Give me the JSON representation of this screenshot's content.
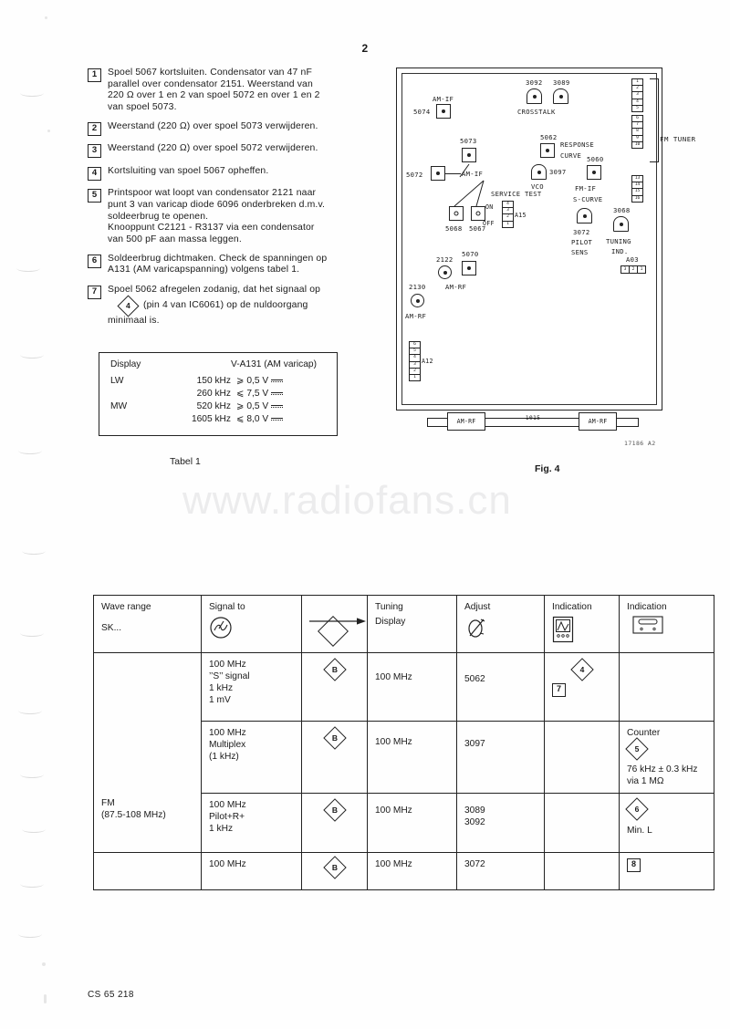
{
  "page": {
    "number": "2",
    "footer_code": "CS 65 218",
    "watermark": "www.radiofans.cn"
  },
  "instructions": [
    {
      "num": "1",
      "lines": [
        "Spoel 5067 kortsluiten. Condensator van 47 nF",
        "parallel over condensator 2151. Weerstand van",
        "220 Ω over 1 en 2 van spoel 5072 en over 1 en 2",
        "van spoel 5073."
      ]
    },
    {
      "num": "2",
      "lines": [
        "Weerstand (220 Ω) over spoel 5073 verwijderen."
      ]
    },
    {
      "num": "3",
      "lines": [
        "Weerstand (220 Ω) over spoel 5072 verwijderen."
      ]
    },
    {
      "num": "4",
      "lines": [
        "Kortsluiting van spoel 5067 opheffen."
      ]
    },
    {
      "num": "5",
      "lines": [
        "Printspoor wat loopt van condensator 2121 naar",
        "punt 3 van varicap diode 6096 onderbreken d.m.v.",
        "soldeerbrug te openen.",
        "Knooppunt C2121 - R3137 via een condensator",
        "van 500 pF aan massa leggen."
      ]
    },
    {
      "num": "6",
      "lines": [
        "Soldeerbrug dichtmaken. Check de spanningen op",
        "A131 (AM varicapspanning) volgens tabel 1."
      ]
    },
    {
      "num": "7",
      "lines": [
        "Spoel 5062 afregelen zodanig, dat het signaal op"
      ],
      "diamond_ref": "4",
      "after_diamond": "(pin 4 van IC6061) op de nuldoorgang",
      "tail": "minimaal is."
    }
  ],
  "tabel1": {
    "caption": "Tabel 1",
    "header": {
      "col1": "Display",
      "col2": "V-A131 (AM varicap)"
    },
    "rows": [
      {
        "band": "LW",
        "freq": "150 kHz",
        "value": "⩾ 0,5 V"
      },
      {
        "band": "",
        "freq": "260 kHz",
        "value": "⩽ 7,5 V"
      },
      {
        "band": "MW",
        "freq": "520 kHz",
        "value": "⩾ 0,5 V"
      },
      {
        "band": "",
        "freq": "1605 kHz",
        "value": "⩽ 8,0 V"
      }
    ]
  },
  "fig4": {
    "caption": "Fig. 4",
    "code": "17186 A2",
    "fm_tuner_label": "FM TUNER",
    "components": [
      {
        "id": "5074",
        "label": "AM-IF"
      },
      {
        "id": "5073",
        "label": "AM-IF"
      },
      {
        "id": "5072",
        "label": "AM-IF"
      },
      {
        "id": "5068",
        "label": ""
      },
      {
        "id": "5067",
        "label": ""
      },
      {
        "id": "3092",
        "label": "CROSSTALK"
      },
      {
        "id": "3089",
        "label": "CROSSTALK"
      },
      {
        "id": "5062",
        "label": "RESPONSE CURVE"
      },
      {
        "id": "3097",
        "label": "VCO"
      },
      {
        "id": "5060",
        "label": "FM-IF S-CURVE"
      },
      {
        "id": "3072",
        "label": "PILOT SENS"
      },
      {
        "id": "3068",
        "label": "TUNING IND."
      },
      {
        "id": "2122",
        "label": "AM-RF"
      },
      {
        "id": "5070",
        "label": "AM-RF"
      },
      {
        "id": "2130",
        "label": "AM-RF"
      }
    ],
    "service_test": {
      "title": "SERVICE TEST",
      "on": "ON",
      "off": "OFF",
      "connector": "A15"
    },
    "connectors": {
      "a12": "A12",
      "a03": "A03",
      "a03_pins": [
        "3",
        "2",
        "1"
      ],
      "a12_pins": [
        "6",
        "5",
        "4",
        "3",
        "2",
        "1"
      ],
      "fm_group1": [
        "1",
        "2",
        "3",
        "4",
        "5"
      ],
      "fm_group2": [
        "6",
        "7",
        "8",
        "9",
        "10"
      ],
      "fm_group3": [
        "13",
        "14",
        "15",
        "16"
      ]
    },
    "bottom_strip": {
      "left_box": "AM-RF",
      "right_box": "AM-RF",
      "middle": "1015"
    }
  },
  "bigtable": {
    "headers": {
      "wave_range": "Wave range",
      "wave_range_sub": "SK...",
      "signal_to": "Signal to",
      "arrow": "",
      "tuning_display_l1": "Tuning",
      "tuning_display_l2": "Display",
      "adjust": "Adjust",
      "indication_1": "Indication",
      "indication_2": "Indication"
    },
    "header_icons": {
      "signal": "signal-generator-icon",
      "arrow": "arrow-right-icon",
      "diamond": "diamond-testpoint-icon",
      "adjust": "trimmer-tool-icon",
      "scope": "oscilloscope-icon",
      "meter": "counter-meter-icon"
    },
    "wave_range": {
      "name": "FM",
      "range": "(87.5-108 MHz)"
    },
    "rows": [
      {
        "signal_lines": [
          "100 MHz",
          "’’S’’ signal",
          "1 kHz",
          "1 mV"
        ],
        "point": "B",
        "tuning_display": "100 MHz",
        "adjust": "5062",
        "indication_1": {
          "diamond": "4",
          "square": "7"
        },
        "indication_2": {
          "lines": []
        }
      },
      {
        "signal_lines": [
          "100 MHz",
          "Multiplex",
          "(1 kHz)"
        ],
        "point": "B",
        "tuning_display": "100 MHz",
        "adjust": "3097",
        "indication_1": {},
        "indication_2": {
          "title": "Counter",
          "diamond": "5",
          "lines": [
            "76 kHz ± 0.3 kHz",
            "via 1 MΩ"
          ]
        }
      },
      {
        "signal_lines": [
          "100 MHz",
          "Pilot+R+",
          "1 kHz"
        ],
        "point": "B",
        "tuning_display": "100 MHz",
        "adjust": "3089\n3092",
        "adjust_lines": [
          "3089",
          "3092"
        ],
        "indication_1": {},
        "indication_2": {
          "diamond": "6",
          "lines": [
            "Min. L"
          ]
        }
      },
      {
        "signal_lines": [
          "100 MHz"
        ],
        "point": "B",
        "tuning_display": "100 MHz",
        "adjust": "3072",
        "indication_1": {},
        "indication_2": {
          "square": "8"
        }
      }
    ]
  }
}
